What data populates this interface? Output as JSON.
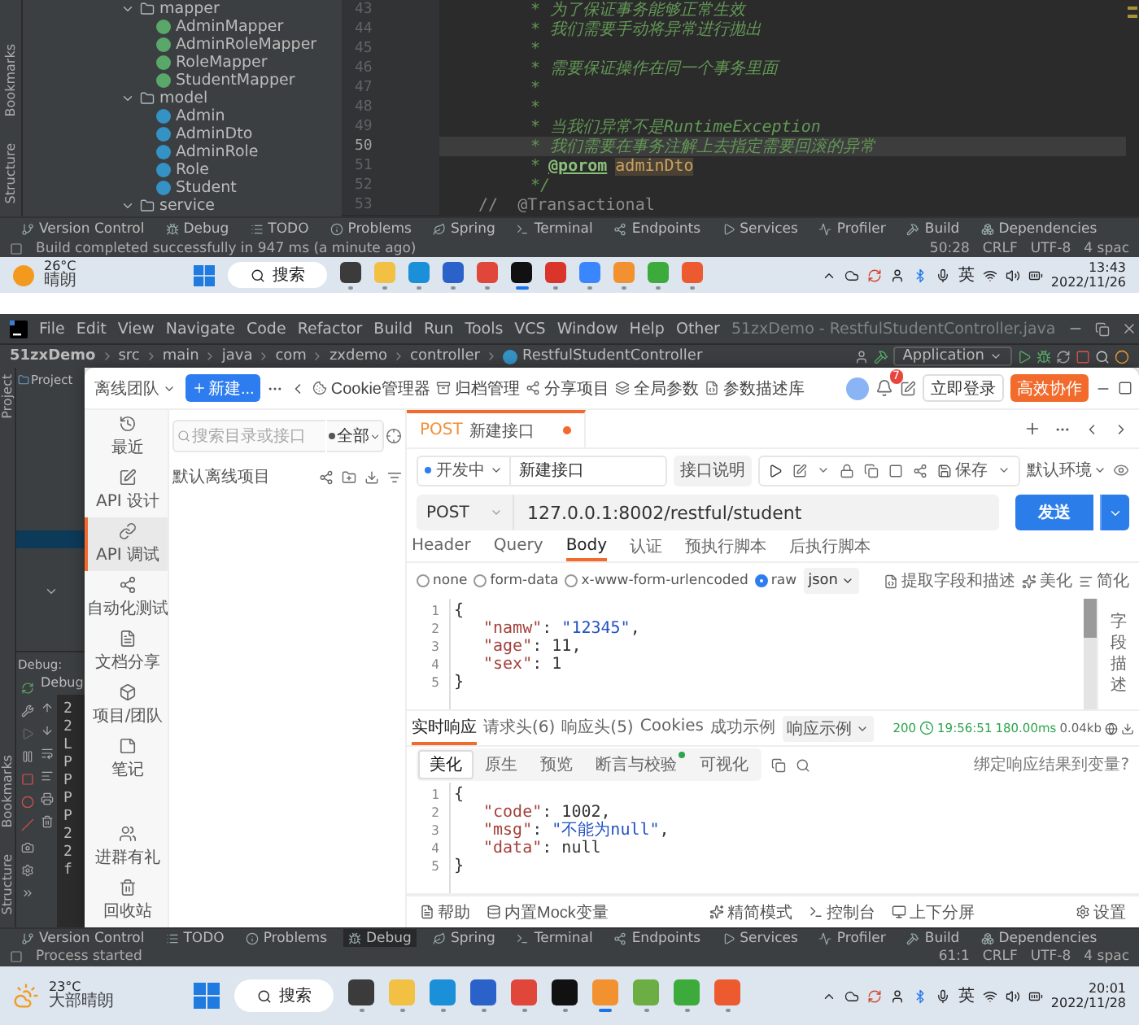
{
  "top_ide": {
    "side_tabs": [
      "Bookmarks",
      "Structure"
    ],
    "tree": [
      {
        "label": "mapper",
        "kind": "folder",
        "expanded": true,
        "children": [
          {
            "label": "AdminMapper",
            "kind": "interface"
          },
          {
            "label": "AdminRoleMapper",
            "kind": "interface"
          },
          {
            "label": "RoleMapper",
            "kind": "interface"
          },
          {
            "label": "StudentMapper",
            "kind": "interface"
          }
        ]
      },
      {
        "label": "model",
        "kind": "folder",
        "expanded": true,
        "children": [
          {
            "label": "Admin",
            "kind": "class"
          },
          {
            "label": "AdminDto",
            "kind": "class"
          },
          {
            "label": "AdminRole",
            "kind": "class"
          },
          {
            "label": "Role",
            "kind": "class"
          },
          {
            "label": "Student",
            "kind": "class"
          }
        ]
      },
      {
        "label": "service",
        "kind": "folder",
        "expanded": true
      }
    ],
    "code_lines": [
      {
        "number": "43",
        "indented": true,
        "selected": false,
        "segments": [
          {
            "text": "* 为了保证事务能够正常生效",
            "kind": "comment"
          }
        ]
      },
      {
        "number": "44",
        "indented": true,
        "selected": false,
        "segments": [
          {
            "text": "* 我们需要手动将异常进行抛出",
            "kind": "comment"
          }
        ]
      },
      {
        "number": "45",
        "indented": true,
        "selected": false,
        "segments": [
          {
            "text": "*",
            "kind": "comment"
          }
        ]
      },
      {
        "number": "46",
        "indented": true,
        "selected": false,
        "segments": [
          {
            "text": "* 需要保证操作在同一个事务里面",
            "kind": "comment"
          }
        ]
      },
      {
        "number": "47",
        "indented": true,
        "selected": false,
        "segments": [
          {
            "text": "*",
            "kind": "comment"
          }
        ]
      },
      {
        "number": "48",
        "indented": true,
        "selected": false,
        "segments": [
          {
            "text": "*",
            "kind": "comment"
          }
        ]
      },
      {
        "number": "49",
        "indented": true,
        "selected": false,
        "segments": [
          {
            "text": "* 当我们异常不是RuntimeException",
            "kind": "comment"
          }
        ]
      },
      {
        "number": "50",
        "indented": true,
        "selected": true,
        "segments": [
          {
            "text": "* 我们需要在事务注解上去指定需要回滚的异常",
            "kind": "comment"
          }
        ]
      },
      {
        "number": "51",
        "indented": true,
        "selected": false,
        "segments": [
          {
            "text": "*",
            "kind": "comment"
          },
          {
            "text": "@porom",
            "kind": "tag"
          },
          {
            "text": "adminDto",
            "kind": "param"
          }
        ]
      },
      {
        "number": "52",
        "indented": true,
        "selected": false,
        "segments": [
          {
            "text": "*/",
            "kind": "comment"
          }
        ]
      },
      {
        "number": "53",
        "indented": false,
        "selected": false,
        "segments": [
          {
            "text": "//  @Transactional",
            "kind": "disabled"
          }
        ]
      }
    ],
    "tool_tabs": [
      {
        "label": "Version Control",
        "kind": "vcs",
        "selected": false
      },
      {
        "label": "Debug",
        "kind": "debug",
        "selected": false
      },
      {
        "label": "TODO",
        "kind": "todo",
        "selected": false
      },
      {
        "label": "Problems",
        "kind": "problems",
        "selected": false
      },
      {
        "label": "Spring",
        "kind": "spring",
        "selected": false
      },
      {
        "label": "Terminal",
        "kind": "terminal",
        "selected": false
      },
      {
        "label": "Endpoints",
        "kind": "endpoints",
        "selected": false
      },
      {
        "label": "Services",
        "kind": "services",
        "selected": false
      },
      {
        "label": "Profiler",
        "kind": "profiler",
        "selected": false
      },
      {
        "label": "Build",
        "kind": "build",
        "selected": false
      },
      {
        "label": "Dependencies",
        "kind": "dependencies",
        "selected": false
      }
    ],
    "status_text": "Build completed successfully in 947 ms (a minute ago)",
    "status_items": [
      "50:28",
      "CRLF",
      "UTF-8",
      "4 spac"
    ]
  },
  "top_taskbar": {
    "weather": {
      "kind": "sunny",
      "temp": "26°C",
      "text": "晴朗"
    },
    "search": "搜索",
    "apps": [
      {
        "kind": "taskview",
        "active": false
      },
      {
        "kind": "explorer",
        "active": false
      },
      {
        "kind": "edge",
        "active": false
      },
      {
        "kind": "store",
        "active": false
      },
      {
        "kind": "chrome",
        "active": false
      },
      {
        "kind": "ide",
        "active": true
      },
      {
        "kind": "wps",
        "active": false
      },
      {
        "kind": "browser",
        "active": false
      },
      {
        "kind": "apifox",
        "active": false
      },
      {
        "kind": "camtasia",
        "active": false
      },
      {
        "kind": "recorder",
        "active": false
      }
    ],
    "ime": "英",
    "time": "13:43",
    "date": "2022/11/26"
  },
  "ide": {
    "menu": [
      "File",
      "Edit",
      "View",
      "Navigate",
      "Code",
      "Refactor",
      "Build",
      "Run",
      "Tools",
      "VCS",
      "Window",
      "Help",
      "Other"
    ],
    "title": "51zxDemo - RestfulStudentController.java",
    "breadcrumb": [
      "51zxDemo",
      "src",
      "main",
      "java",
      "com",
      "zxdemo",
      "controller",
      "RestfulStudentController"
    ],
    "run_config": "Application",
    "side_tab": "Project",
    "side_tabs_bottom": [
      "Bookmarks",
      "Structure"
    ],
    "project_tab": "Project",
    "debug_label": "Debug:",
    "debug_tab": "Debug",
    "debug_lines": [
      "2",
      "2",
      "L",
      "P",
      "P",
      "P",
      "P",
      "2",
      "2",
      "f"
    ],
    "tool_tabs": [
      {
        "label": "Version Control",
        "kind": "vcs",
        "selected": false
      },
      {
        "label": "TODO",
        "kind": "todo",
        "selected": false
      },
      {
        "label": "Problems",
        "kind": "problems",
        "selected": false
      },
      {
        "label": "Debug",
        "kind": "debug",
        "selected": true
      },
      {
        "label": "Spring",
        "kind": "spring",
        "selected": false
      },
      {
        "label": "Terminal",
        "kind": "terminal",
        "selected": false
      },
      {
        "label": "Endpoints",
        "kind": "endpoints",
        "selected": false
      },
      {
        "label": "Services",
        "kind": "services",
        "selected": false
      },
      {
        "label": "Profiler",
        "kind": "profiler",
        "selected": false
      },
      {
        "label": "Build",
        "kind": "build",
        "selected": false
      },
      {
        "label": "Dependencies",
        "kind": "dependencies",
        "selected": false
      }
    ],
    "status_text": "Process started",
    "status_items": [
      "61:1",
      "CRLF",
      "UTF-8",
      "4 spac"
    ]
  },
  "api": {
    "team": "离线团队",
    "new_button": "新建...",
    "toolbar": [
      {
        "label": "Cookie管理器",
        "kind": "cookie"
      },
      {
        "label": "归档管理",
        "kind": "archive"
      },
      {
        "label": "分享项目",
        "kind": "share"
      },
      {
        "label": "全局参数",
        "kind": "params"
      },
      {
        "label": "参数描述库",
        "kind": "library"
      }
    ],
    "notifications": "7",
    "login": "立即登录",
    "collab": "高效协作",
    "nav": [
      {
        "label": "最近",
        "kind": "recent",
        "selected": false
      },
      {
        "label": "API 设计",
        "kind": "design",
        "selected": false
      },
      {
        "label": "API 调试",
        "kind": "debug",
        "selected": true
      },
      {
        "label": "自动化测试",
        "kind": "autotest",
        "selected": false
      },
      {
        "label": "文档分享",
        "kind": "docs",
        "selected": false
      },
      {
        "label": "项目/团队",
        "kind": "project",
        "selected": false
      },
      {
        "label": "笔记",
        "kind": "notes",
        "selected": false
      },
      {
        "label": "进群有礼",
        "kind": "group",
        "selected": false
      },
      {
        "label": "回收站",
        "kind": "trash",
        "selected": false
      }
    ],
    "tree": {
      "search_placeholder": "搜索目录或接口",
      "filter": "全部",
      "project": "默认离线项目"
    },
    "tab": {
      "method": "POST",
      "name": "新建接口",
      "unsaved": true
    },
    "status": "开发中",
    "name_value": "新建接口",
    "doc_button": "接口说明",
    "save": "保存",
    "env": "默认环境",
    "method": "POST",
    "url": "127.0.0.1:8002/restful/student",
    "send": "发送",
    "request_tabs": [
      {
        "label": "Header",
        "selected": false
      },
      {
        "label": "Query",
        "selected": false
      },
      {
        "label": "Body",
        "selected": true
      },
      {
        "label": "认证",
        "selected": false
      },
      {
        "label": "预执行脚本",
        "selected": false
      },
      {
        "label": "后执行脚本",
        "selected": false
      }
    ],
    "body_modes": [
      {
        "label": "none",
        "selected": false
      },
      {
        "label": "form-data",
        "selected": false
      },
      {
        "label": "x-www-form-urlencoded",
        "selected": false
      },
      {
        "label": "raw",
        "selected": true
      }
    ],
    "body_format": "json",
    "body_actions": [
      {
        "label": "提取字段和描述",
        "kind": "extract"
      },
      {
        "label": "美化",
        "kind": "beautify"
      },
      {
        "label": "简化",
        "kind": "simplify"
      }
    ],
    "body_lines": [
      {
        "number": "1",
        "indented": false,
        "segments": [
          {
            "text": "{",
            "kind": "punct"
          }
        ]
      },
      {
        "number": "2",
        "indented": true,
        "segments": [
          {
            "text": "\"namw\"",
            "kind": "key"
          },
          {
            "text": ": ",
            "kind": "punct"
          },
          {
            "text": "\"12345\"",
            "kind": "string"
          },
          {
            "text": ",",
            "kind": "punct"
          }
        ]
      },
      {
        "number": "3",
        "indented": true,
        "segments": [
          {
            "text": "\"age\"",
            "kind": "key"
          },
          {
            "text": ": ",
            "kind": "punct"
          },
          {
            "text": "11",
            "kind": "number"
          },
          {
            "text": ",",
            "kind": "punct"
          }
        ]
      },
      {
        "number": "4",
        "indented": true,
        "segments": [
          {
            "text": "\"sex\"",
            "kind": "key"
          },
          {
            "text": ": ",
            "kind": "punct"
          },
          {
            "text": "1",
            "kind": "number"
          }
        ]
      },
      {
        "number": "5",
        "indented": false,
        "segments": [
          {
            "text": "}",
            "kind": "punct"
          }
        ]
      }
    ],
    "field_desc": "字段描述",
    "response_tabs": [
      {
        "label": "实时响应",
        "selected": true
      },
      {
        "label": "请求头(6)",
        "selected": false
      },
      {
        "label": "响应头(5)",
        "selected": false
      },
      {
        "label": "Cookies",
        "selected": false
      },
      {
        "label": "成功示例",
        "selected": false
      }
    ],
    "example_select": "响应示例",
    "response_status": {
      "code": "200",
      "time": "19:56:51",
      "duration": "180.00ms",
      "size": "0.04kb"
    },
    "view_tabs": [
      {
        "label": "美化",
        "selected": true,
        "indicator": false
      },
      {
        "label": "原生",
        "selected": false,
        "indicator": false
      },
      {
        "label": "预览",
        "selected": false,
        "indicator": false
      },
      {
        "label": "断言与校验",
        "selected": false,
        "indicator": true
      },
      {
        "label": "可视化",
        "selected": false,
        "indicator": false
      }
    ],
    "bind_link": "绑定响应结果到变量?",
    "response_lines": [
      {
        "number": "1",
        "indented": false,
        "segments": [
          {
            "text": "{",
            "kind": "punct"
          }
        ]
      },
      {
        "number": "2",
        "indented": true,
        "segments": [
          {
            "text": "\"code\"",
            "kind": "key"
          },
          {
            "text": ": ",
            "kind": "punct"
          },
          {
            "text": "1002",
            "kind": "number"
          },
          {
            "text": ",",
            "kind": "punct"
          }
        ]
      },
      {
        "number": "3",
        "indented": true,
        "segments": [
          {
            "text": "\"msg\"",
            "kind": "key"
          },
          {
            "text": ": ",
            "kind": "punct"
          },
          {
            "text": "\"不能为null\"",
            "kind": "string"
          },
          {
            "text": ",",
            "kind": "punct"
          }
        ]
      },
      {
        "number": "4",
        "indented": true,
        "segments": [
          {
            "text": "\"data\"",
            "kind": "key"
          },
          {
            "text": ": ",
            "kind": "punct"
          },
          {
            "text": "null",
            "kind": "number"
          }
        ]
      },
      {
        "number": "5",
        "indented": false,
        "segments": [
          {
            "text": "}",
            "kind": "punct"
          }
        ]
      }
    ],
    "footer": {
      "left": [
        {
          "label": "帮助",
          "kind": "help"
        },
        {
          "label": "内置Mock变量",
          "kind": "mock"
        }
      ],
      "center": [
        {
          "label": "精简模式",
          "kind": "compact"
        },
        {
          "label": "控制台",
          "kind": "console"
        },
        {
          "label": "上下分屏",
          "kind": "split"
        }
      ],
      "right": [
        {
          "label": "设置",
          "kind": "settings"
        }
      ]
    }
  },
  "bottom_taskbar": {
    "weather": {
      "kind": "partly-cloudy",
      "temp": "23°C",
      "text": "大部晴朗"
    },
    "search": "搜索",
    "apps": [
      {
        "kind": "taskview",
        "active": false
      },
      {
        "kind": "explorer",
        "active": false
      },
      {
        "kind": "edge",
        "active": false
      },
      {
        "kind": "store",
        "active": false
      },
      {
        "kind": "chrome",
        "active": false
      },
      {
        "kind": "ide",
        "active": false
      },
      {
        "kind": "apifox",
        "active": true
      },
      {
        "kind": "paint",
        "active": false
      },
      {
        "kind": "camtasia",
        "active": false
      },
      {
        "kind": "recorder",
        "active": false
      }
    ],
    "ime": "英",
    "time": "20:01",
    "date": "2022/11/28"
  }
}
